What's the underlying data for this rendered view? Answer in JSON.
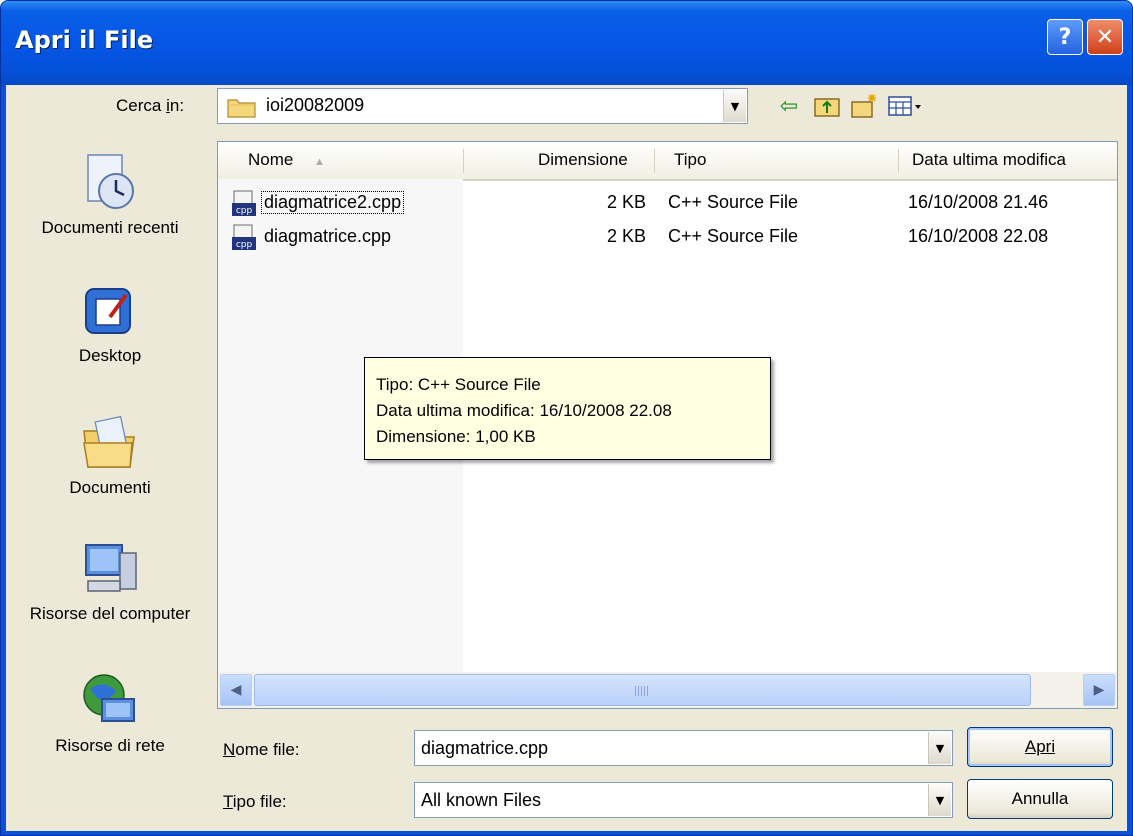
{
  "window": {
    "title": "Apri il File",
    "help_label": "?",
    "close_label": "✕"
  },
  "lookin": {
    "label": "Cerca in:",
    "folder": "ioi20082009",
    "tools": [
      "back-arrow-icon",
      "up-folder-icon",
      "new-folder-icon",
      "view-menu-icon"
    ]
  },
  "places": [
    {
      "label": "Documenti recenti",
      "icon": "recent-documents-icon"
    },
    {
      "label": "Desktop",
      "icon": "desktop-icon"
    },
    {
      "label": "Documenti",
      "icon": "my-documents-icon"
    },
    {
      "label": "Risorse del computer",
      "icon": "my-computer-icon"
    },
    {
      "label": "Risorse di rete",
      "icon": "network-places-icon"
    }
  ],
  "list": {
    "columns": [
      "Nome",
      "Dimensione",
      "Tipo",
      "Data ultima modifica"
    ],
    "rows": [
      {
        "name": "diagmatrice2.cpp",
        "size": "2 KB",
        "type": "C++ Source File",
        "date": "16/10/2008 21.46",
        "focused": true
      },
      {
        "name": "diagmatrice.cpp",
        "size": "2 KB",
        "type": "C++ Source File",
        "date": "16/10/2008 22.08",
        "focused": false
      }
    ]
  },
  "tooltip": {
    "line1": "Tipo: C++ Source File",
    "line2": "Data ultima modifica: 16/10/2008 22.08",
    "line3": "Dimensione: 1,00 KB"
  },
  "form": {
    "filename_label": "Nome file:",
    "filename_value": "diagmatrice.cpp",
    "filetype_label": "Tipo file:",
    "filetype_value": "All known Files"
  },
  "buttons": {
    "open": "Apri",
    "cancel": "Annulla"
  },
  "colors": {
    "titlebar": "#0a5fe6",
    "dialog_bg": "#ece9d8",
    "tooltip_bg": "#ffffe1"
  }
}
